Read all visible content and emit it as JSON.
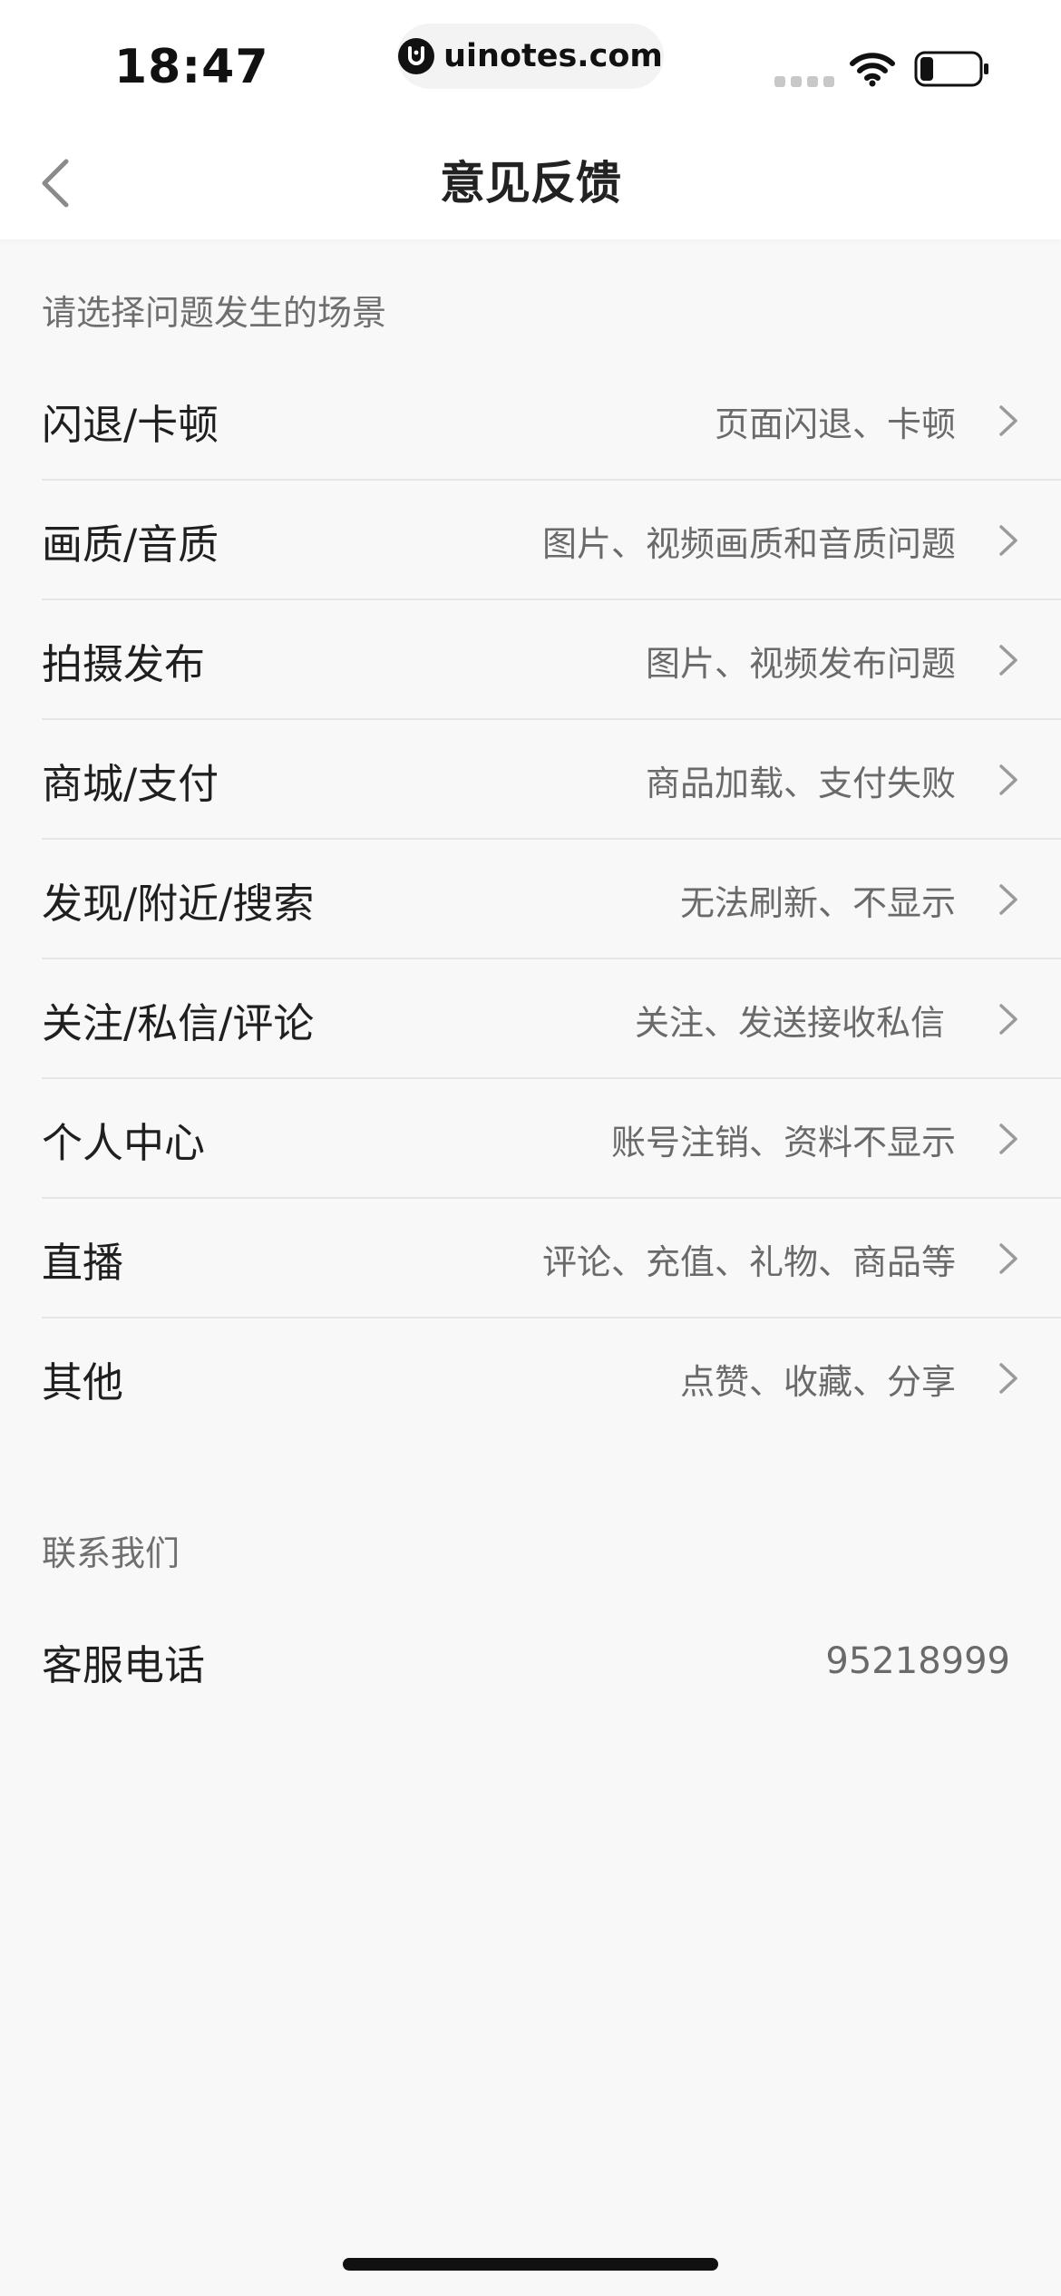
{
  "status_bar": {
    "time": "18:47",
    "url": "uinotes.com"
  },
  "nav": {
    "title": "意见反馈",
    "back_icon": "chevron-left-icon"
  },
  "scene_section": {
    "header": "请选择问题发生的场景",
    "items": [
      {
        "title": "闪退/卡顿",
        "desc": "页面闪退、卡顿"
      },
      {
        "title": "画质/音质",
        "desc": "图片、视频画质和音质问题"
      },
      {
        "title": "拍摄发布",
        "desc": "图片、视频发布问题"
      },
      {
        "title": "商城/支付",
        "desc": "商品加载、支付失败"
      },
      {
        "title": "发现/附近/搜索",
        "desc": "无法刷新、不显示"
      },
      {
        "title": "关注/私信/评论",
        "desc": "关注、发送接收私信"
      },
      {
        "title": "个人中心",
        "desc": "账号注销、资料不显示"
      },
      {
        "title": "直播",
        "desc": "评论、充值、礼物、商品等"
      },
      {
        "title": "其他",
        "desc": "点赞、收藏、分享"
      }
    ]
  },
  "contact_section": {
    "header": "联系我们",
    "phone_label": "客服电话",
    "phone_value": "95218999"
  },
  "colors": {
    "background": "#f8f8f8",
    "nav_background": "#ffffff",
    "text_primary": "#1f1f1f",
    "text_secondary": "#6a6a6a",
    "divider": "#e6e6e6"
  }
}
